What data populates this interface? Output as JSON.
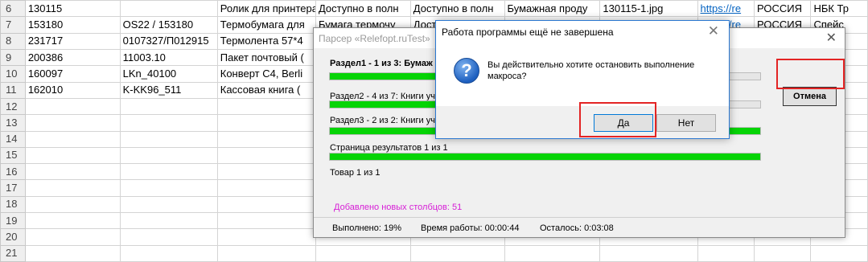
{
  "sheet": {
    "rows": [
      {
        "num": "6",
        "a": "130115",
        "b": "",
        "c": "Ролик для принтера без перф. НБК",
        "d": "Доступно в полн",
        "e": "Доступно в полн",
        "f": "Бумажная проду",
        "g": "130115-1.jpg",
        "h": "https://re",
        "i": "РОССИЯ",
        "j": "НБК Тр"
      },
      {
        "num": "7",
        "a": "153180",
        "b": "OS22 / 153180",
        "c": "Термобумага для",
        "d": "Бумага термочу",
        "e": "Доступно в полн",
        "f": "",
        "g": "",
        "h": "https://re",
        "i": "РОССИЯ",
        "j": "Спейс"
      },
      {
        "num": "8",
        "a": "231717",
        "b": "0107327/П012915",
        "c": "Термолента 57*4",
        "d": "Лента",
        "e": "",
        "f": "",
        "g": "",
        "h": "",
        "i": "",
        "j": "Спейс"
      },
      {
        "num": "9",
        "a": "200386",
        "b": "11003.10",
        "c": "Пакет почтовый (",
        "d": "Пакет",
        "e": "",
        "f": "",
        "g": "",
        "h": "",
        "i": "",
        "j": "ромот"
      },
      {
        "num": "10",
        "a": "160097",
        "b": "LKn_40100",
        "c": "Конверт С4, Berli",
        "d": "Конв",
        "e": "",
        "f": "",
        "g": "",
        "h": "",
        "i": "",
        "j": "erling"
      },
      {
        "num": "11",
        "a": "162010",
        "b": "K-KK96_511",
        "c": "Кассовая книга (",
        "d": "Касс",
        "e": "",
        "f": "",
        "g": "",
        "h": "",
        "i": "",
        "j": "Спейс"
      },
      {
        "num": "12",
        "a": "",
        "b": "",
        "c": "",
        "d": "",
        "e": "",
        "f": "",
        "g": "",
        "h": "",
        "i": "",
        "j": ""
      },
      {
        "num": "13",
        "a": "",
        "b": "",
        "c": "",
        "d": "",
        "e": "",
        "f": "",
        "g": "",
        "h": "",
        "i": "",
        "j": ""
      },
      {
        "num": "14",
        "a": "",
        "b": "",
        "c": "",
        "d": "",
        "e": "",
        "f": "",
        "g": "",
        "h": "",
        "i": "",
        "j": ""
      },
      {
        "num": "15",
        "a": "",
        "b": "",
        "c": "",
        "d": "",
        "e": "",
        "f": "",
        "g": "",
        "h": "",
        "i": "",
        "j": ""
      },
      {
        "num": "16",
        "a": "",
        "b": "",
        "c": "",
        "d": "",
        "e": "",
        "f": "",
        "g": "",
        "h": "",
        "i": "",
        "j": ""
      },
      {
        "num": "17",
        "a": "",
        "b": "",
        "c": "",
        "d": "",
        "e": "",
        "f": "",
        "g": "",
        "h": "",
        "i": "",
        "j": ""
      },
      {
        "num": "18",
        "a": "",
        "b": "",
        "c": "",
        "d": "",
        "e": "",
        "f": "",
        "g": "",
        "h": "",
        "i": "",
        "j": ""
      },
      {
        "num": "19",
        "a": "",
        "b": "",
        "c": "",
        "d": "",
        "e": "",
        "f": "",
        "g": "",
        "h": "",
        "i": "",
        "j": ""
      },
      {
        "num": "20",
        "a": "",
        "b": "",
        "c": "",
        "d": "",
        "e": "",
        "f": "",
        "g": "",
        "h": "",
        "i": "",
        "j": ""
      },
      {
        "num": "21",
        "a": "",
        "b": "",
        "c": "",
        "d": "",
        "e": "",
        "f": "",
        "g": "",
        "h": "",
        "i": "",
        "j": ""
      }
    ]
  },
  "parser": {
    "title": "Парсер «Relefopt.ruTest»",
    "section1": "Раздел1 - 1 из 3: Бумаж",
    "section1_progress": 0.25,
    "section2": "Раздел2 - 4 из 7: Книги уч",
    "section2_progress": 0.3,
    "section3": "Раздел3 - 2 из 2: Книги уч",
    "section3_progress": 1.0,
    "results_page": "Страница результатов 1 из 1",
    "results_progress": 1.0,
    "item": "Товар 1 из 1",
    "added_columns": "Добавлено новых столбцов: 51",
    "done": "Выполнено: 19%",
    "work_time": "Время работы: 00:00:44",
    "remaining": "Осталось: 0:03:08",
    "cancel_label": "Отмена",
    "close_glyph": "✕"
  },
  "confirm": {
    "title": "Работа программы ещё не завершена",
    "message": "Вы действительно хотите остановить выполнение макроса?",
    "yes_label": "Да",
    "no_label": "Нет",
    "icon_glyph": "?",
    "close_glyph": "✕"
  },
  "colors": {
    "progress_fill": "#06d406",
    "highlight": "#e32424",
    "added_text": "#d61ed6"
  }
}
